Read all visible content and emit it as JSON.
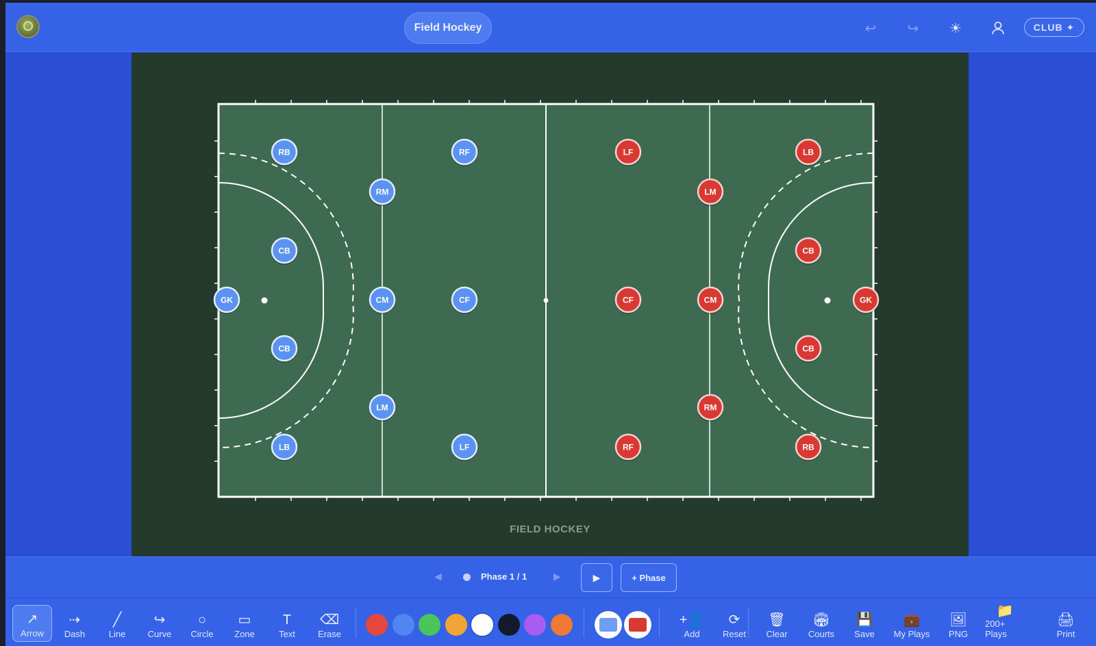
{
  "header": {
    "title": "Field Hockey",
    "logo_icon": "club-logo-icon",
    "club_label": "CLUB ✦",
    "icons": [
      "undo-icon",
      "redo-icon",
      "sun-icon",
      "user-icon"
    ]
  },
  "field": {
    "caption": "FIELD HOCKEY",
    "colors": {
      "background": "#233a2c",
      "pitch": "#3f6a52",
      "lines": "#ffffff"
    },
    "blue_team": {
      "color": "#5b93f2",
      "players": [
        "GK",
        "RB",
        "CB",
        "CB",
        "LB",
        "RM",
        "CM",
        "LM",
        "RF",
        "CF",
        "LF"
      ]
    },
    "red_team": {
      "color": "#d83a33",
      "players": [
        "GK",
        "LB",
        "CB",
        "CB",
        "RB",
        "LM",
        "CM",
        "RM",
        "LF",
        "CF",
        "RF"
      ]
    }
  },
  "phase": {
    "label": "Phase 1 / 1",
    "add_label": "+ Phase",
    "play_icon": "play-icon"
  },
  "toolbar": {
    "tools": [
      {
        "label": "Arrow",
        "icon": "arrow-icon"
      },
      {
        "label": "Dash",
        "icon": "dash-arrow-icon"
      },
      {
        "label": "Line",
        "icon": "line-icon"
      },
      {
        "label": "Curve",
        "icon": "curve-icon"
      },
      {
        "label": "Circle",
        "icon": "circle-icon"
      },
      {
        "label": "Zone",
        "icon": "zone-icon"
      },
      {
        "label": "Text",
        "icon": "text-icon"
      },
      {
        "label": "Erase",
        "icon": "eraser-icon"
      }
    ],
    "colors": [
      "#e5473e",
      "#4f86f0",
      "#4cc45a",
      "#f0a534",
      "#ffffff",
      "#141a2e",
      "#a85cf0",
      "#f07a34"
    ],
    "actions": [
      {
        "label": "Add",
        "icon": "add-player-icon"
      },
      {
        "label": "Reset",
        "icon": "reset-icon"
      },
      {
        "label": "Clear",
        "icon": "trash-icon"
      },
      {
        "label": "Courts",
        "icon": "courts-icon"
      },
      {
        "label": "Save",
        "icon": "save-icon"
      },
      {
        "label": "My Plays",
        "icon": "briefcase-icon"
      },
      {
        "label": "PNG",
        "icon": "image-icon"
      },
      {
        "label": "200+ Plays",
        "icon": "folder-icon"
      },
      {
        "label": "Print",
        "icon": "printer-icon"
      }
    ]
  }
}
